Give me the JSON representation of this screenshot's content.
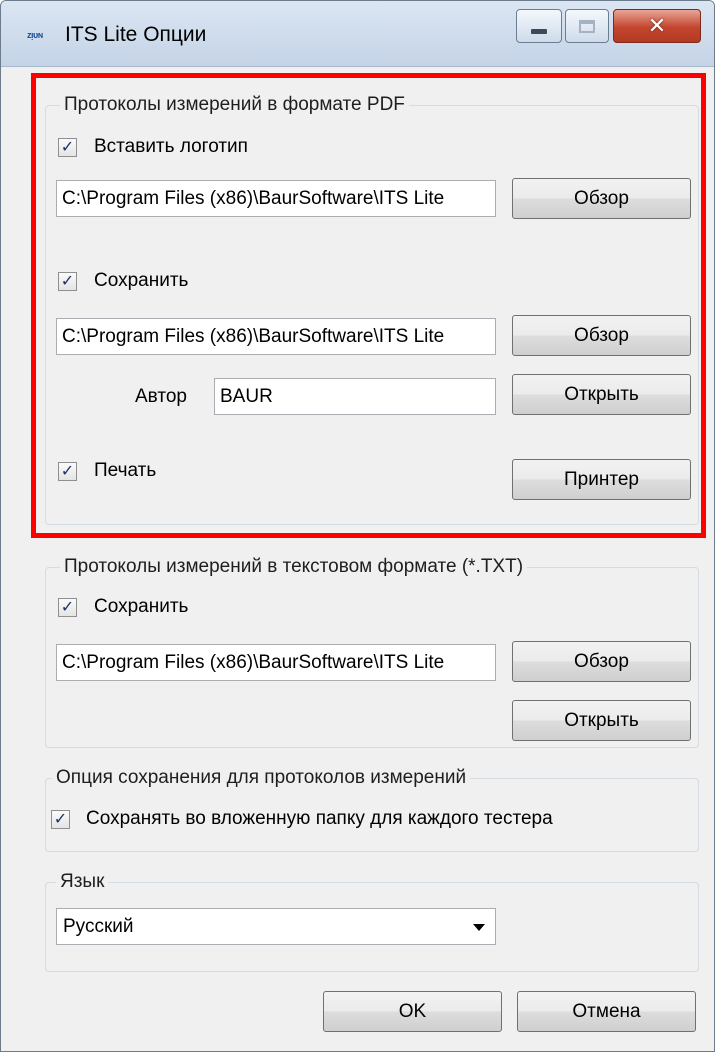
{
  "window": {
    "title": "ITS Lite Опции",
    "icon_text": "ᴢᴉᴜɴ"
  },
  "pdf_group": {
    "label": "Протоколы измерений в формате PDF",
    "insert_logo": {
      "label": "Вставить логотип",
      "checked": true,
      "glyph": "✓"
    },
    "logo_path": "C:\\Program Files (x86)\\BaurSoftware\\ITS Lite",
    "browse1": "Обзор",
    "save": {
      "label": "Сохранить",
      "checked": true,
      "glyph": "✓"
    },
    "save_path": "C:\\Program Files (x86)\\BaurSoftware\\ITS Lite",
    "browse2": "Обзор",
    "author_label": "Автор",
    "author_value": "BAUR",
    "open": "Открыть",
    "print": {
      "label": "Печать",
      "checked": true,
      "glyph": "✓"
    },
    "printer": "Принтер"
  },
  "txt_group": {
    "label": "Протоколы измерений в текстовом формате (*.TXT)",
    "save": {
      "label": "Сохранить",
      "checked": true,
      "glyph": "✓"
    },
    "save_path": "C:\\Program Files (x86)\\BaurSoftware\\ITS Lite",
    "browse": "Обзор",
    "open": "Открыть"
  },
  "save_option_group": {
    "label": "Опция сохранения для протоколов измерений",
    "subfolder": {
      "label": "Сохранять во вложенную папку для каждого тестера",
      "checked": true,
      "glyph": "✓"
    }
  },
  "language_group": {
    "label": "Язык",
    "selected": "Русский"
  },
  "footer": {
    "ok": "OK",
    "cancel": "Отмена"
  },
  "colors": {
    "highlight": "#ff0000",
    "close_button": "#c4452e"
  },
  "icons": {
    "minimize": "minimize-icon",
    "maximize": "maximize-icon",
    "close": "close-icon",
    "dropdown": "chevron-down-icon"
  }
}
